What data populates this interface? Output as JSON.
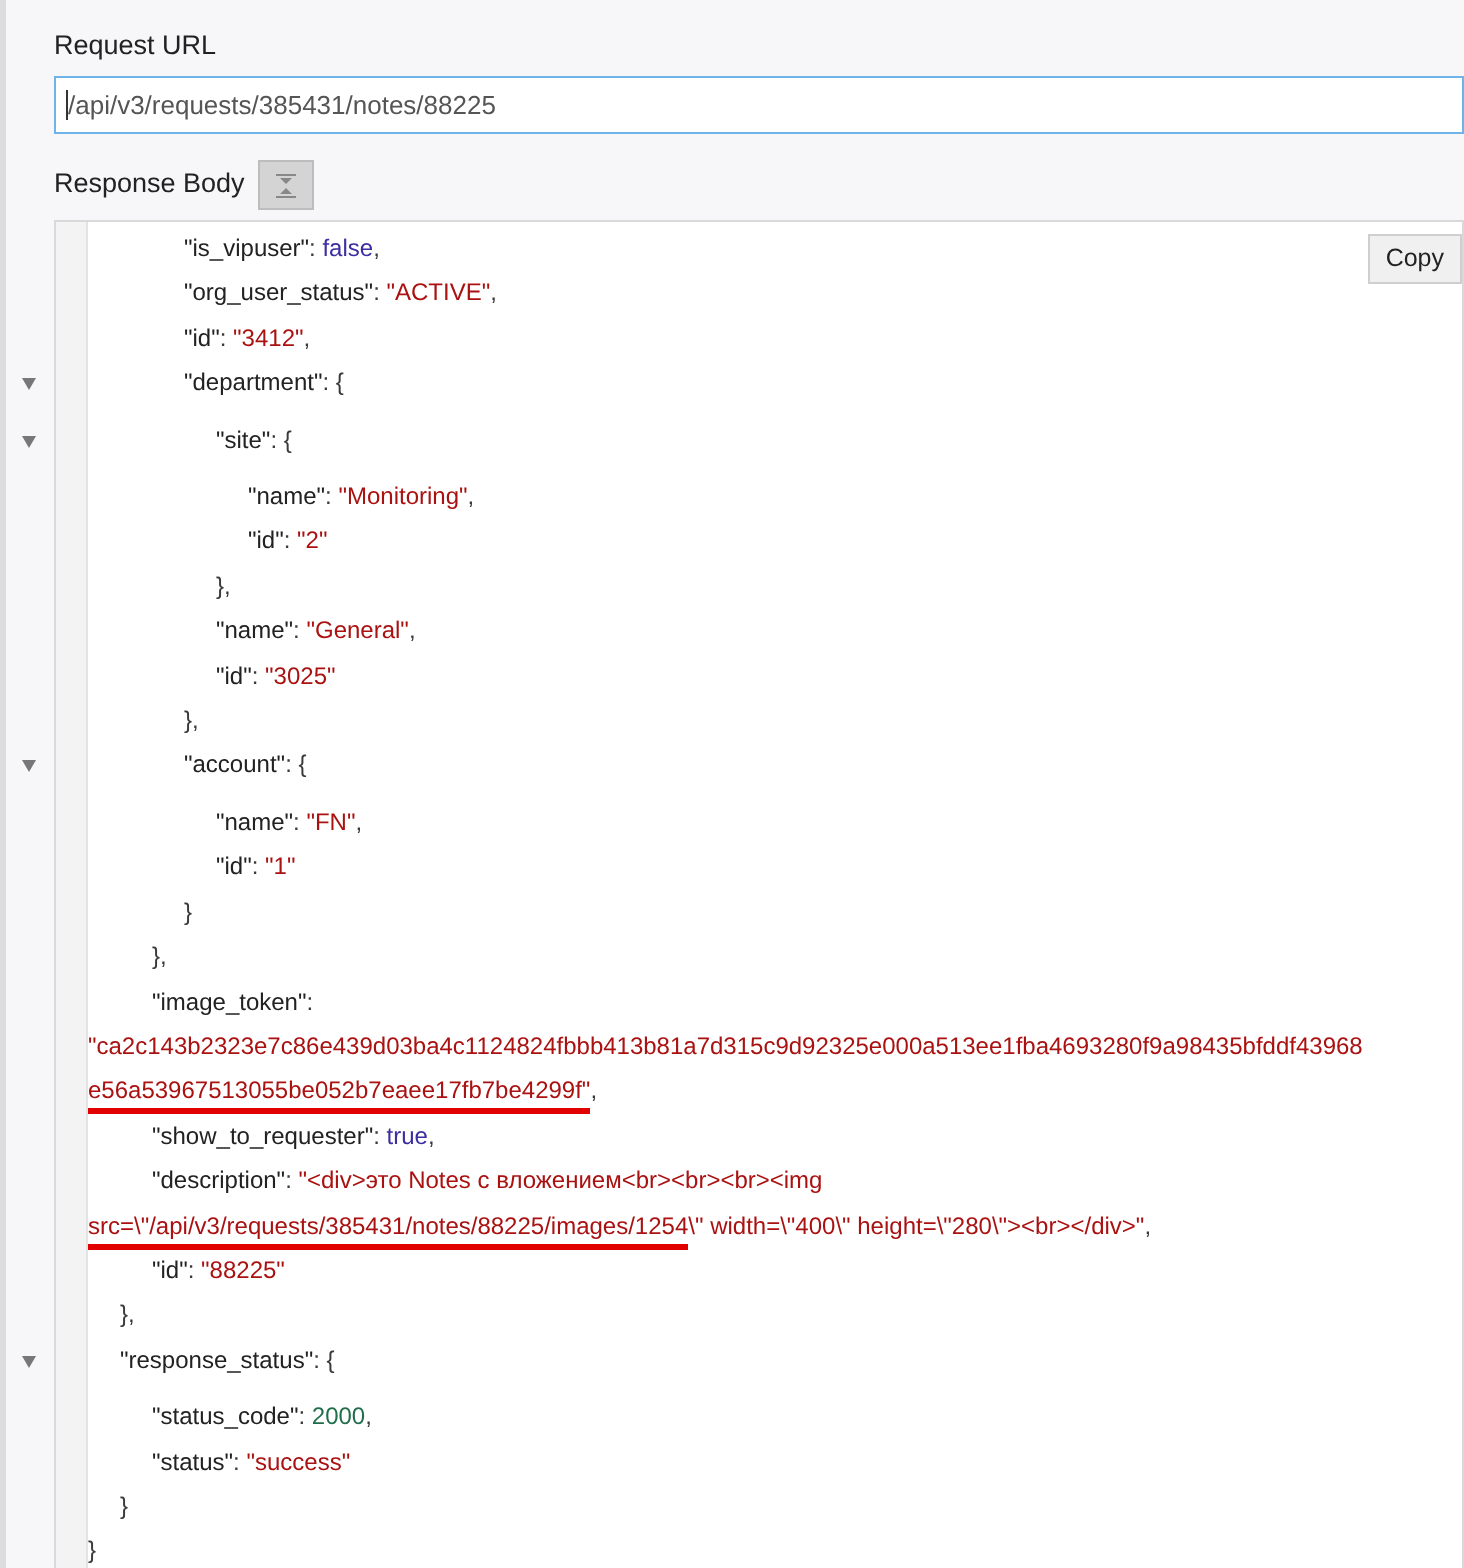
{
  "request_url": {
    "label": "Request URL",
    "value": "/api/v3/requests/385431/notes/88225"
  },
  "response_body": {
    "label": "Response Body",
    "copy_button": "Copy",
    "lines": [
      {
        "kind": "block",
        "children": [
          {
            "kind": "block",
            "children": [
              {
                "kind": "block",
                "children": [
                  {
                    "kind": "line",
                    "parts": [
                      {
                        "kind": "key",
                        "text": "\"is_vipuser\""
                      },
                      {
                        "kind": "punct",
                        "text": ": "
                      },
                      {
                        "kind": "keyword",
                        "text": "false"
                      },
                      {
                        "kind": "punct",
                        "text": ","
                      }
                    ]
                  },
                  {
                    "kind": "line",
                    "parts": [
                      {
                        "kind": "key",
                        "text": "\"org_user_status\""
                      },
                      {
                        "kind": "punct",
                        "text": ": "
                      },
                      {
                        "kind": "string",
                        "text": "\"ACTIVE\""
                      },
                      {
                        "kind": "punct",
                        "text": ","
                      }
                    ]
                  },
                  {
                    "kind": "line",
                    "parts": [
                      {
                        "kind": "key",
                        "text": "\"id\""
                      },
                      {
                        "kind": "punct",
                        "text": ": "
                      },
                      {
                        "kind": "string",
                        "text": "\"3412\""
                      },
                      {
                        "kind": "punct",
                        "text": ","
                      }
                    ]
                  },
                  {
                    "kind": "fold",
                    "parts": [
                      {
                        "kind": "key",
                        "text": "\"department\""
                      },
                      {
                        "kind": "punct",
                        "text": ": {"
                      }
                    ]
                  },
                  {
                    "kind": "block",
                    "children": [
                      {
                        "kind": "fold",
                        "parts": [
                          {
                            "kind": "key",
                            "text": "\"site\""
                          },
                          {
                            "kind": "punct",
                            "text": ": {"
                          }
                        ]
                      },
                      {
                        "kind": "block",
                        "children": [
                          {
                            "kind": "line",
                            "parts": [
                              {
                                "kind": "key",
                                "text": "\"name\""
                              },
                              {
                                "kind": "punct",
                                "text": ": "
                              },
                              {
                                "kind": "string",
                                "text": "\"Monitoring\""
                              },
                              {
                                "kind": "punct",
                                "text": ","
                              }
                            ]
                          },
                          {
                            "kind": "line",
                            "parts": [
                              {
                                "kind": "key",
                                "text": "\"id\""
                              },
                              {
                                "kind": "punct",
                                "text": ": "
                              },
                              {
                                "kind": "string",
                                "text": "\"2\""
                              }
                            ]
                          }
                        ]
                      },
                      {
                        "kind": "line",
                        "parts": [
                          {
                            "kind": "punct",
                            "text": "},"
                          }
                        ]
                      },
                      {
                        "kind": "line",
                        "parts": [
                          {
                            "kind": "key",
                            "text": "\"name\""
                          },
                          {
                            "kind": "punct",
                            "text": ": "
                          },
                          {
                            "kind": "string",
                            "text": "\"General\""
                          },
                          {
                            "kind": "punct",
                            "text": ","
                          }
                        ]
                      },
                      {
                        "kind": "line",
                        "parts": [
                          {
                            "kind": "key",
                            "text": "\"id\""
                          },
                          {
                            "kind": "punct",
                            "text": ": "
                          },
                          {
                            "kind": "string",
                            "text": "\"3025\""
                          }
                        ]
                      }
                    ]
                  },
                  {
                    "kind": "line",
                    "parts": [
                      {
                        "kind": "punct",
                        "text": "},"
                      }
                    ]
                  },
                  {
                    "kind": "fold",
                    "parts": [
                      {
                        "kind": "key",
                        "text": "\"account\""
                      },
                      {
                        "kind": "punct",
                        "text": ": {"
                      }
                    ]
                  },
                  {
                    "kind": "block",
                    "children": [
                      {
                        "kind": "line",
                        "parts": [
                          {
                            "kind": "key",
                            "text": "\"name\""
                          },
                          {
                            "kind": "punct",
                            "text": ": "
                          },
                          {
                            "kind": "string",
                            "text": "\"FN\""
                          },
                          {
                            "kind": "punct",
                            "text": ","
                          }
                        ]
                      },
                      {
                        "kind": "line",
                        "parts": [
                          {
                            "kind": "key",
                            "text": "\"id\""
                          },
                          {
                            "kind": "punct",
                            "text": ": "
                          },
                          {
                            "kind": "string",
                            "text": "\"1\""
                          }
                        ]
                      }
                    ]
                  },
                  {
                    "kind": "line",
                    "parts": [
                      {
                        "kind": "punct",
                        "text": "}"
                      }
                    ]
                  }
                ]
              },
              {
                "kind": "line",
                "parts": [
                  {
                    "kind": "punct",
                    "text": "},"
                  }
                ]
              },
              {
                "kind": "line",
                "parts": [
                  {
                    "kind": "key",
                    "text": "\"image_token\""
                  },
                  {
                    "kind": "punct",
                    "text": ":"
                  }
                ]
              }
            ]
          }
        ]
      },
      {
        "kind": "line",
        "parts": [
          {
            "kind": "string",
            "text": "\"ca2c143b2323e7c86e439d03ba4c1124824fbbb413b81a7d315c9d92325e000a513ee1fba4693280f9a98435bfddf43968"
          }
        ]
      },
      {
        "kind": "line",
        "parts": [
          {
            "kind": "string",
            "text": "e56a53967513055be052b7eaee17fb7be4299f\"",
            "underline": true
          },
          {
            "kind": "punct",
            "text": ","
          }
        ]
      },
      {
        "kind": "block",
        "children": [
          {
            "kind": "block",
            "children": [
              {
                "kind": "line",
                "parts": [
                  {
                    "kind": "key",
                    "text": "\"show_to_requester\""
                  },
                  {
                    "kind": "punct",
                    "text": ": "
                  },
                  {
                    "kind": "keyword",
                    "text": "true"
                  },
                  {
                    "kind": "punct",
                    "text": ","
                  }
                ]
              },
              {
                "kind": "line",
                "parts": [
                  {
                    "kind": "key",
                    "text": "\"description\""
                  },
                  {
                    "kind": "punct",
                    "text": ": "
                  },
                  {
                    "kind": "string",
                    "text": "\"<div>это Notes с вложением<br><br><br><img"
                  }
                ]
              }
            ]
          }
        ]
      },
      {
        "kind": "line",
        "parts": [
          {
            "kind": "string",
            "text": "src=\\\"/api/v3/requests/385431/notes/88225/images/1254",
            "underline": true
          },
          {
            "kind": "string",
            "text": "\\\" width=\\\"400\\\" height=\\\"280\\\"><br></div>\""
          },
          {
            "kind": "punct",
            "text": ","
          }
        ]
      },
      {
        "kind": "block",
        "children": [
          {
            "kind": "block",
            "children": [
              {
                "kind": "line",
                "parts": [
                  {
                    "kind": "key",
                    "text": "\"id\""
                  },
                  {
                    "kind": "punct",
                    "text": ": "
                  },
                  {
                    "kind": "string",
                    "text": "\"88225\""
                  }
                ]
              }
            ]
          },
          {
            "kind": "line",
            "parts": [
              {
                "kind": "punct",
                "text": "},"
              }
            ]
          },
          {
            "kind": "fold",
            "parts": [
              {
                "kind": "key",
                "text": "\"response_status\""
              },
              {
                "kind": "punct",
                "text": ": {"
              }
            ]
          },
          {
            "kind": "block",
            "children": [
              {
                "kind": "line",
                "parts": [
                  {
                    "kind": "key",
                    "text": "\"status_code\""
                  },
                  {
                    "kind": "punct",
                    "text": ": "
                  },
                  {
                    "kind": "number",
                    "text": "2000"
                  },
                  {
                    "kind": "punct",
                    "text": ","
                  }
                ]
              },
              {
                "kind": "line",
                "parts": [
                  {
                    "kind": "key",
                    "text": "\"status\""
                  },
                  {
                    "kind": "punct",
                    "text": ": "
                  },
                  {
                    "kind": "string",
                    "text": "\"success\""
                  }
                ]
              }
            ]
          },
          {
            "kind": "line",
            "parts": [
              {
                "kind": "punct",
                "text": "}"
              }
            ]
          }
        ]
      },
      {
        "kind": "line",
        "parts": [
          {
            "kind": "punct",
            "text": "}"
          }
        ]
      }
    ]
  }
}
